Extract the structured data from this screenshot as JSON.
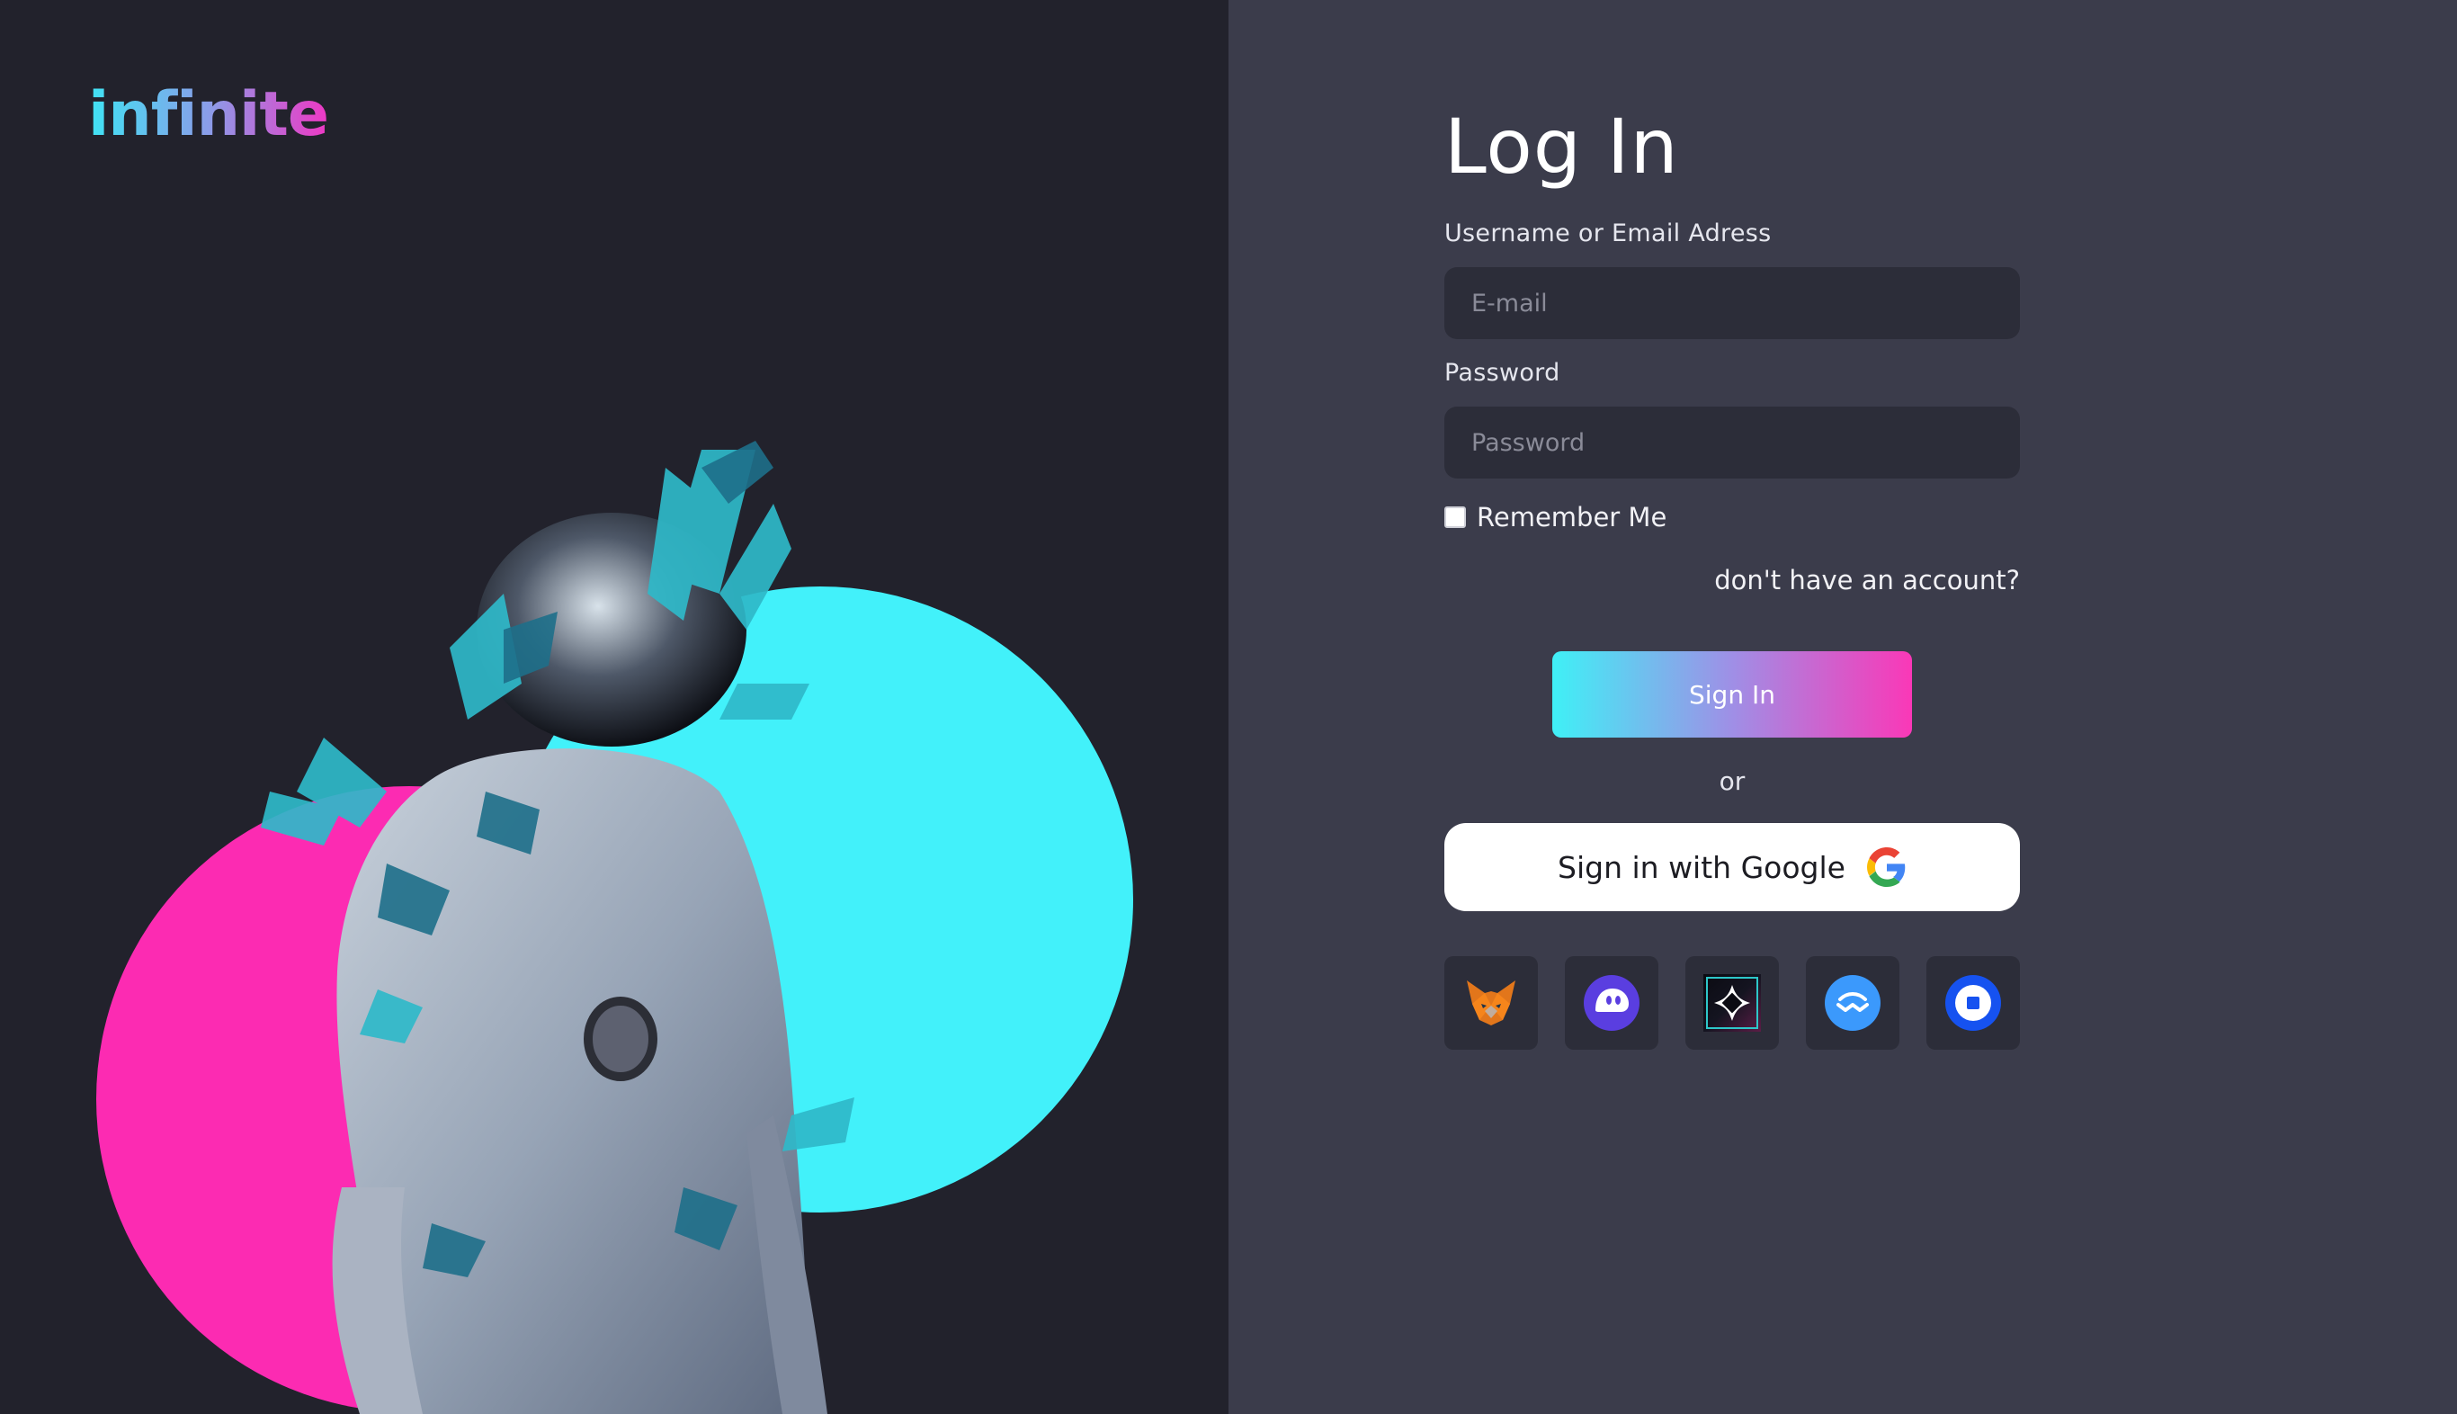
{
  "brand": {
    "logo_text": "infinite"
  },
  "login": {
    "title": "Log In",
    "username_label": "Username or Email Adress",
    "email_placeholder": "E-mail",
    "password_label": "Password",
    "password_placeholder": "Password",
    "remember_label": "Remember Me",
    "remember_checked": false,
    "account_link": "don't have an account?",
    "signin_label": "Sign In",
    "or_text": "or",
    "google_label": "Sign in with Google"
  },
  "wallets": [
    {
      "icon": "metamask-fox-icon"
    },
    {
      "icon": "phantom-ghost-icon"
    },
    {
      "icon": "dark-square-wallet-icon"
    },
    {
      "icon": "walletconnect-icon"
    },
    {
      "icon": "coinbase-wallet-icon"
    }
  ],
  "colors": {
    "left_bg": "#22222c",
    "right_bg": "#3b3c4b",
    "input_bg": "#2c2d39",
    "accent_cyan": "#3ff0f6",
    "accent_pink": "#fa38b7"
  }
}
